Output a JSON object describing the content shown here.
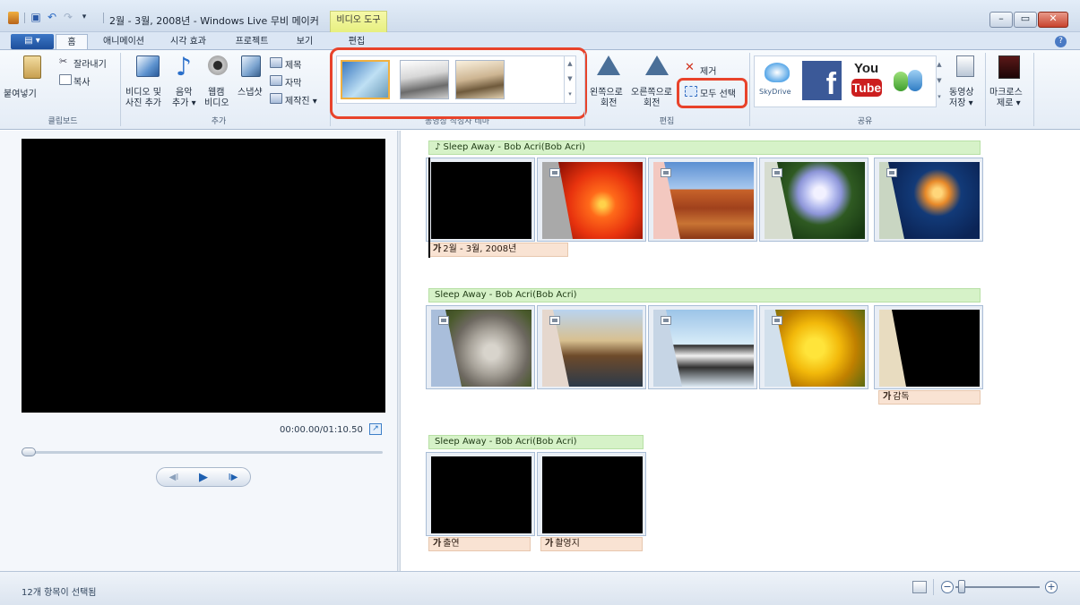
{
  "window": {
    "title": "2월 - 3월, 2008년 - Windows Live 무비 메이커",
    "context_tab": "비디오 도구"
  },
  "tabs": {
    "file": "▤ ▾",
    "items": [
      "홈",
      "애니메이션",
      "시각 효과",
      "프로젝트",
      "보기",
      "편집"
    ]
  },
  "ribbon": {
    "clipboard": {
      "paste": "붙여넣기",
      "cut": "잘라내기",
      "copy": "복사",
      "label": "클립보드"
    },
    "add": {
      "add_videos_line1": "비디오 및",
      "add_videos_line2": "사진 추가",
      "music_line1": "음악",
      "music_line2": "추가 ▾",
      "webcam_line1": "웹캠",
      "webcam_line2": "비디오",
      "snapshot": "스냅샷",
      "title": "제목",
      "caption": "자막",
      "credits": "제작진 ▾",
      "label": "추가"
    },
    "themes_label": "동영상 작성자 테마",
    "editing": {
      "rotate_left_line1": "왼쪽으로",
      "rotate_left_line2": "회전",
      "rotate_right_line1": "오른쪽으로",
      "rotate_right_line2": "회전",
      "remove": "제거",
      "select_all": "모두 선택",
      "label": "편집"
    },
    "share": {
      "skydrive": "SkyDrive",
      "facebook": "f",
      "youtube_top": "You",
      "youtube_bottom": "Tube",
      "save_movie_line1": "동영상",
      "save_movie_line2": "저장 ▾",
      "label": "공유"
    },
    "macros": {
      "line1": "마크로스",
      "line2": "제로 ▾"
    }
  },
  "preview": {
    "timecode": "00:00.00/01:10.50",
    "controls": [
      "◀Ⅰ",
      "▶",
      "Ⅰ▶"
    ]
  },
  "storyboard": {
    "music_tracks": [
      "♪ Sleep Away - Bob Acri(Bob Acri)",
      "Sleep Away - Bob Acri(Bob Acri)",
      "Sleep Away - Bob Acri(Bob Acri)"
    ],
    "caption_prefix": "가",
    "captions": [
      "2월 - 3월, 2008년",
      "감독",
      "출연",
      "촬영지"
    ]
  },
  "status": {
    "text": "12개 항목이 선택됨"
  },
  "colors": {
    "highlight_box": "#e8432b",
    "music_bar": "#d6f2c8",
    "caption_bar": "#f9e3d3",
    "ribbon_bg": "#e4ecf6"
  }
}
